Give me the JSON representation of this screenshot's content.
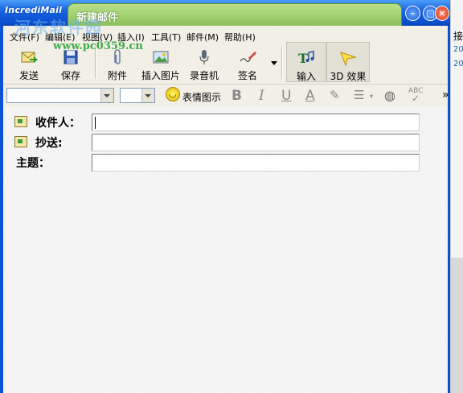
{
  "window": {
    "app_logo": "IncrediMail",
    "title": "新建邮件",
    "watermark_site": "河东软件园",
    "watermark_url": "www.pc0359.cn"
  },
  "menu": [
    "文件(F)",
    "编辑(E)",
    "视图(V)",
    "插入(I)",
    "工具(T)",
    "邮件(M)",
    "帮助(H)"
  ],
  "toolbar": {
    "send": "发送",
    "save": "保存",
    "attach": "附件",
    "insert_image": "插入图片",
    "recorder": "录音机",
    "signature": "签名",
    "input": "输入",
    "effect_3d": "3D 效果"
  },
  "format": {
    "emoticons": "表情图示",
    "bold": "B",
    "italic": "I",
    "underline": "U",
    "font_color": "A",
    "spellcheck": "ABC",
    "more": "»"
  },
  "fields": {
    "to_label": "收件人：",
    "cc_label": "抄送:",
    "subject_label": "主题："
  },
  "background_window": {
    "top_text": "接",
    "row1": "20",
    "row2": "20"
  }
}
